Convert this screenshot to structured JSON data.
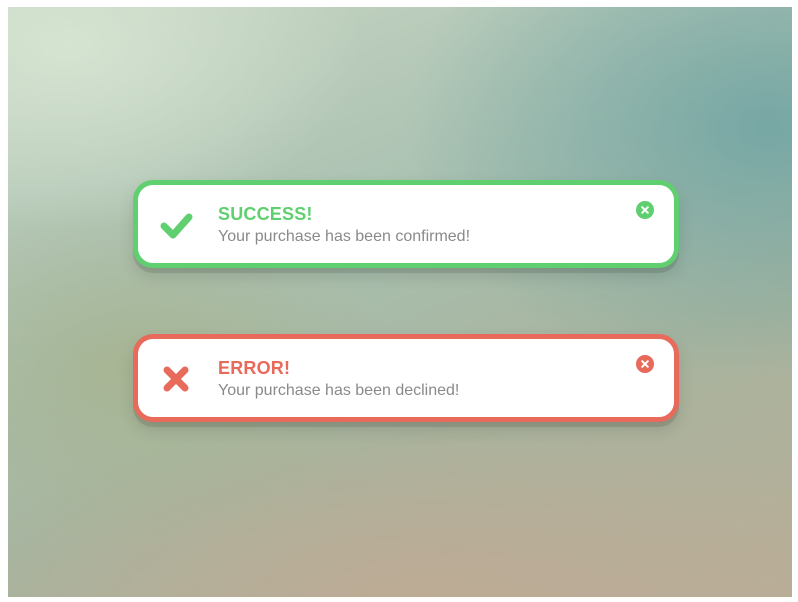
{
  "notifications": [
    {
      "type": "success",
      "icon": "checkmark-icon",
      "title": "SUCCESS!",
      "message": "Your purchase has been confirmed!",
      "close_icon": "close-icon",
      "color": "#5fcf6f"
    },
    {
      "type": "error",
      "icon": "cross-icon",
      "title": "ERROR!",
      "message": "Your purchase has been declined!",
      "close_icon": "close-icon",
      "color": "#e86a5a"
    }
  ]
}
